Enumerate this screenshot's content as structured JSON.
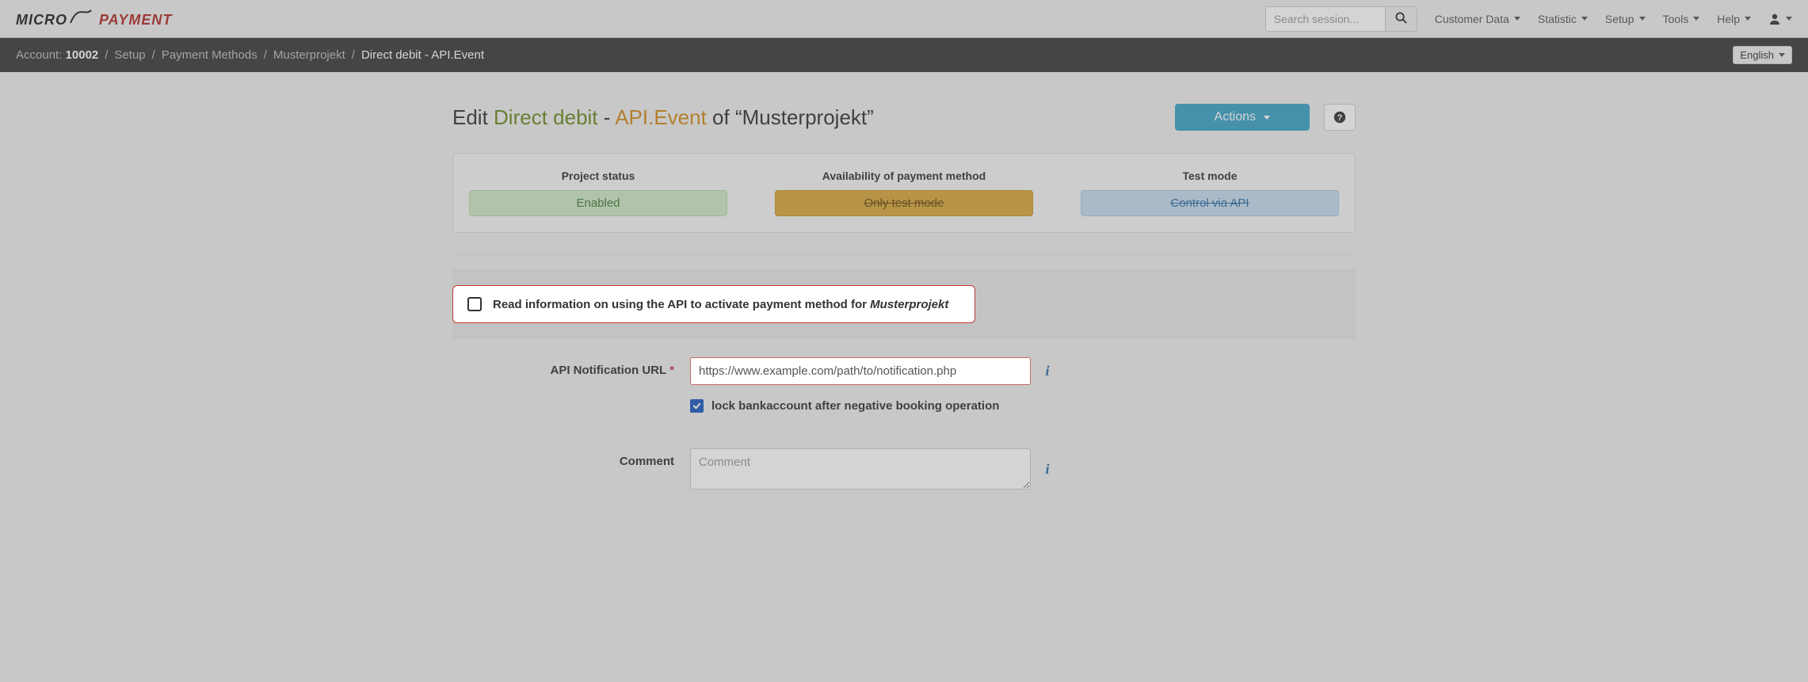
{
  "nav": {
    "search_placeholder": "Search session...",
    "items": {
      "customer_data": "Customer Data",
      "statistic": "Statistic",
      "setup": "Setup",
      "tools": "Tools",
      "help": "Help"
    }
  },
  "breadcrumb": {
    "account_label": "Account:",
    "account_id": "10002",
    "setup": "Setup",
    "payment_methods": "Payment Methods",
    "project": "Musterprojekt",
    "current": "Direct debit - API.Event",
    "language": "English"
  },
  "heading": {
    "edit": "Edit ",
    "method": "Direct debit",
    "dash": " - ",
    "api": "API.Event",
    "of_prefix": " of “",
    "project": "Musterprojekt",
    "of_suffix": "”",
    "actions_label": "Actions"
  },
  "status": {
    "project_status_label": "Project status",
    "project_status_value": "Enabled",
    "availability_label": "Availability of payment method",
    "availability_value": "Only test mode",
    "test_mode_label": "Test mode",
    "test_mode_value": "Control via API"
  },
  "callout": {
    "text_prefix": "Read information on using the API to activate payment method for ",
    "project": "Musterprojekt"
  },
  "form": {
    "api_url_label": "API Notification URL",
    "api_url_value": "https://www.example.com/path/to/notification.php",
    "lock_label": "lock bankaccount after negative booking operation",
    "comment_label": "Comment",
    "comment_placeholder": "Comment"
  }
}
